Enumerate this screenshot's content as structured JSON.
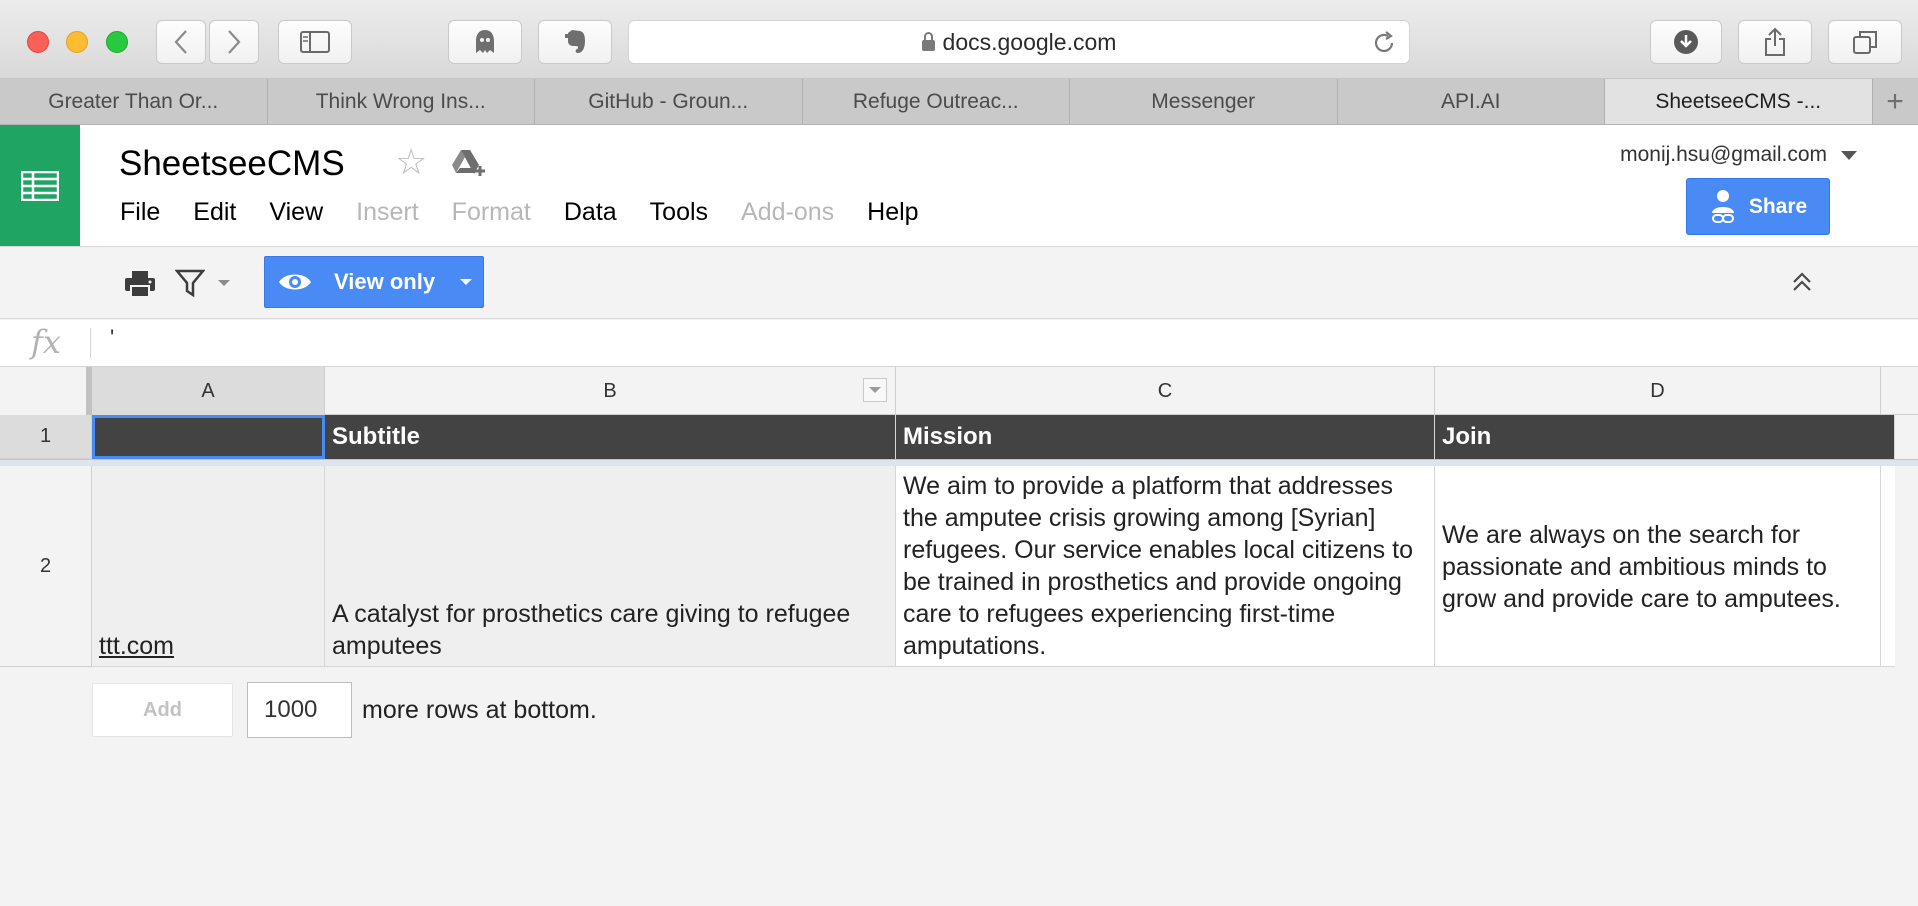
{
  "browser": {
    "url": "docs.google.com",
    "tabs": [
      {
        "label": "Greater Than Or..."
      },
      {
        "label": "Think Wrong Ins..."
      },
      {
        "label": "GitHub - Groun..."
      },
      {
        "label": "Refuge Outreac..."
      },
      {
        "label": "Messenger"
      },
      {
        "label": "API.AI"
      },
      {
        "label": "SheetseeCMS -..."
      }
    ],
    "active_tab_index": 6,
    "new_tab_label": "+"
  },
  "sheet": {
    "title": "SheetseeCMS",
    "menu": [
      {
        "label": "File",
        "enabled": true
      },
      {
        "label": "Edit",
        "enabled": true
      },
      {
        "label": "View",
        "enabled": true
      },
      {
        "label": "Insert",
        "enabled": false
      },
      {
        "label": "Format",
        "enabled": false
      },
      {
        "label": "Data",
        "enabled": true
      },
      {
        "label": "Tools",
        "enabled": true
      },
      {
        "label": "Add-ons",
        "enabled": false
      },
      {
        "label": "Help",
        "enabled": true
      }
    ],
    "account": "monij.hsu@gmail.com",
    "share_label": "Share",
    "view_only_label": "View only",
    "formula_label": "fx",
    "formula_value": "'",
    "columns": [
      "A",
      "B",
      "C",
      "D"
    ],
    "rows": [
      "1",
      "2"
    ],
    "header_row": [
      "",
      "Subtitle",
      "Mission",
      "Join"
    ],
    "data_row": {
      "a_link": "ttt.com",
      "b": "A catalyst for prosthetics care giving to refugee amputees",
      "c": "We aim to provide a platform that addresses the amputee crisis growing among [Syrian] refugees. Our service enables local citizens to be trained in prosthetics and provide ongoing care to refugees experiencing first-time amputations.",
      "d": "We are always on the search for passionate and ambitious minds to grow and provide care to amputees."
    },
    "add_label": "Add",
    "add_count": "1000",
    "more_rows_label": "more rows at bottom."
  },
  "colors": {
    "sheets_green": "#1fa463",
    "accent_blue": "#4a8af4",
    "header_dark": "#434343"
  }
}
